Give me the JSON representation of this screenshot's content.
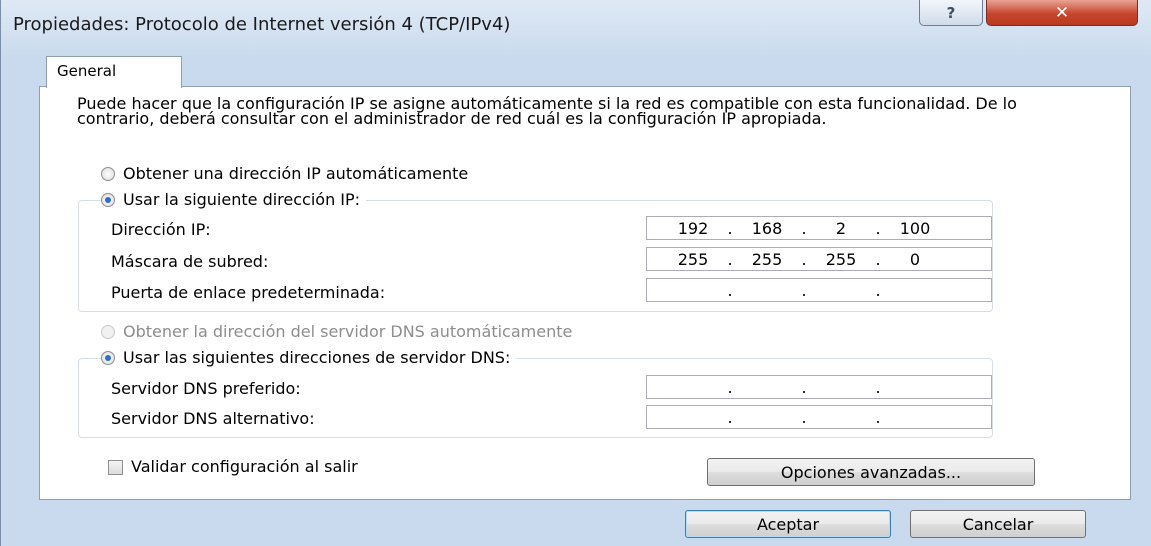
{
  "window": {
    "title": "Propiedades: Protocolo de Internet versión 4 (TCP/IPv4)",
    "help_glyph": "?",
    "close_glyph": "✕"
  },
  "tabs": {
    "general": "General"
  },
  "intro_text": "Puede hacer que la configuración IP se asigne automáticamente si la red es compatible con esta funcionalidad. De lo contrario, deberá consultar con el administrador de red cuál es la configuración IP apropiada.",
  "ip": {
    "auto_label": "Obtener una dirección IP automáticamente",
    "manual_label": "Usar la siguiente dirección IP:",
    "selected": "manual",
    "address_label": "Dirección IP:",
    "address": [
      "192",
      "168",
      "2",
      "100"
    ],
    "mask_label": "Máscara de subred:",
    "mask": [
      "255",
      "255",
      "255",
      "0"
    ],
    "gateway_label": "Puerta de enlace predeterminada:",
    "gateway": [
      "",
      "",
      "",
      ""
    ]
  },
  "dns": {
    "auto_label": "Obtener la dirección del servidor DNS automáticamente",
    "manual_label": "Usar las siguientes direcciones de servidor DNS:",
    "selected": "manual",
    "preferred_label": "Servidor DNS preferido:",
    "preferred": [
      "",
      "",
      "",
      ""
    ],
    "alternate_label": "Servidor DNS alternativo:",
    "alternate": [
      "",
      "",
      "",
      ""
    ]
  },
  "validate_label": "Validar configuración al salir",
  "validate_checked": false,
  "buttons": {
    "advanced": "Opciones avanzadas...",
    "ok": "Aceptar",
    "cancel": "Cancelar"
  },
  "colors": {
    "close_button": "#c7452d",
    "radio_selected": "#2a6fc9"
  }
}
